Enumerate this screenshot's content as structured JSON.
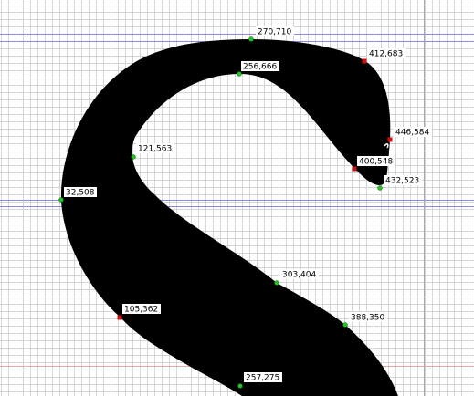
{
  "editor": {
    "grid_color": "#d4d4d4",
    "guide_color": "#8a8ae0",
    "vertical_guide_color": "#a8a8a8",
    "baseline_color": "#e0a8a8",
    "glyph_fill": "#000000",
    "oncurve_color": "#22c322",
    "offcurve_color": "#cc1111"
  },
  "points": [
    {
      "label": "270,710",
      "kind": "on-curve"
    },
    {
      "label": "412,683",
      "kind": "off-curve"
    },
    {
      "label": "256,666",
      "kind": "on-curve"
    },
    {
      "label": "446,584",
      "kind": "off-curve"
    },
    {
      "label": "121,563",
      "kind": "on-curve"
    },
    {
      "label": "400,548",
      "kind": "off-curve"
    },
    {
      "label": "432,523",
      "kind": "on-curve"
    },
    {
      "label": "32,508",
      "kind": "on-curve"
    },
    {
      "label": "303,404",
      "kind": "on-curve"
    },
    {
      "label": "105,362",
      "kind": "off-curve"
    },
    {
      "label": "388,350",
      "kind": "on-curve"
    },
    {
      "label": "257,275",
      "kind": "on-curve"
    }
  ]
}
